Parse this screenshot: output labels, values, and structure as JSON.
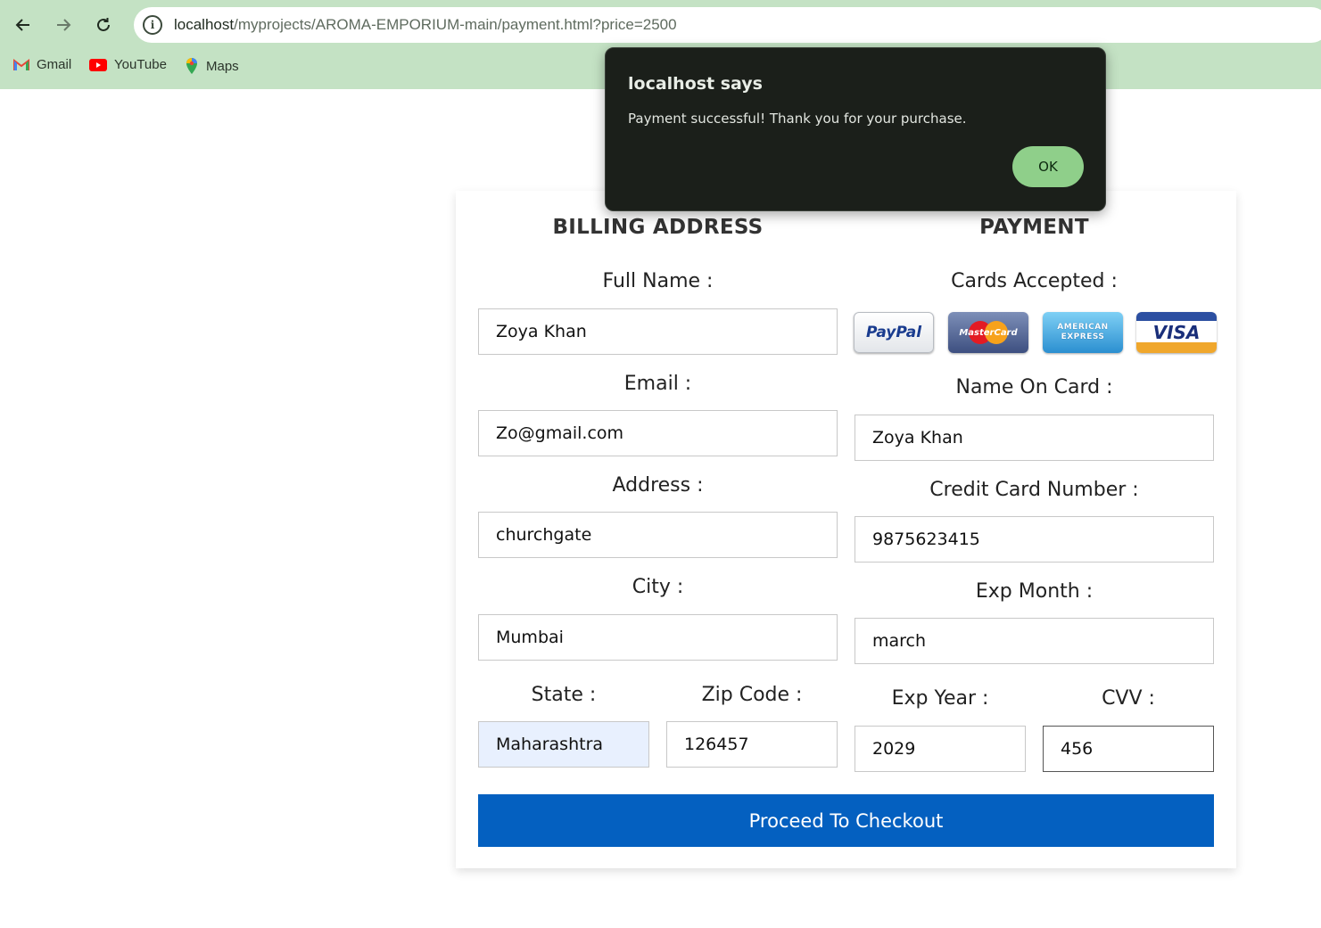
{
  "browser": {
    "url_host": "localhost",
    "url_path": "/myprojects/AROMA-EMPORIUM-main/payment.html?price=2500",
    "bookmarks": [
      {
        "label": "Gmail",
        "icon": "gmail-icon"
      },
      {
        "label": "YouTube",
        "icon": "youtube-icon"
      },
      {
        "label": "Maps",
        "icon": "maps-icon"
      }
    ]
  },
  "billing": {
    "title": "BILLING ADDRESS",
    "full_name_label": "Full Name :",
    "full_name_value": "Zoya Khan",
    "email_label": "Email :",
    "email_value": "Zo@gmail.com",
    "address_label": "Address :",
    "address_value": "churchgate",
    "city_label": "City :",
    "city_value": "Mumbai",
    "state_label": "State :",
    "state_value": "Maharashtra",
    "zip_label": "Zip Code :",
    "zip_value": "126457"
  },
  "payment": {
    "title": "PAYMENT",
    "cards_label": "Cards Accepted :",
    "cards": [
      {
        "name": "PayPal",
        "icon": "paypal-icon"
      },
      {
        "name": "MasterCard",
        "icon": "mastercard-icon"
      },
      {
        "name": "AMERICAN EXPRESS",
        "icon": "amex-icon"
      },
      {
        "name": "VISA",
        "icon": "visa-icon"
      }
    ],
    "name_on_card_label": "Name On Card :",
    "name_on_card_value": "Zoya Khan",
    "card_number_label": "Credit Card Number :",
    "card_number_value": "9875623415",
    "exp_month_label": "Exp Month :",
    "exp_month_value": "march",
    "exp_year_label": "Exp Year :",
    "exp_year_value": "2029",
    "cvv_label": "CVV :",
    "cvv_value": "456"
  },
  "checkout_label": "Proceed To Checkout",
  "dialog": {
    "title": "localhost says",
    "message": "Payment successful! Thank you for your purchase.",
    "ok_label": "OK"
  },
  "colors": {
    "chrome_bg": "#c4e2c4",
    "checkout_bg": "#0460c0",
    "dialog_bg": "#1b1f1a",
    "ok_bg": "#8fcf8a"
  }
}
